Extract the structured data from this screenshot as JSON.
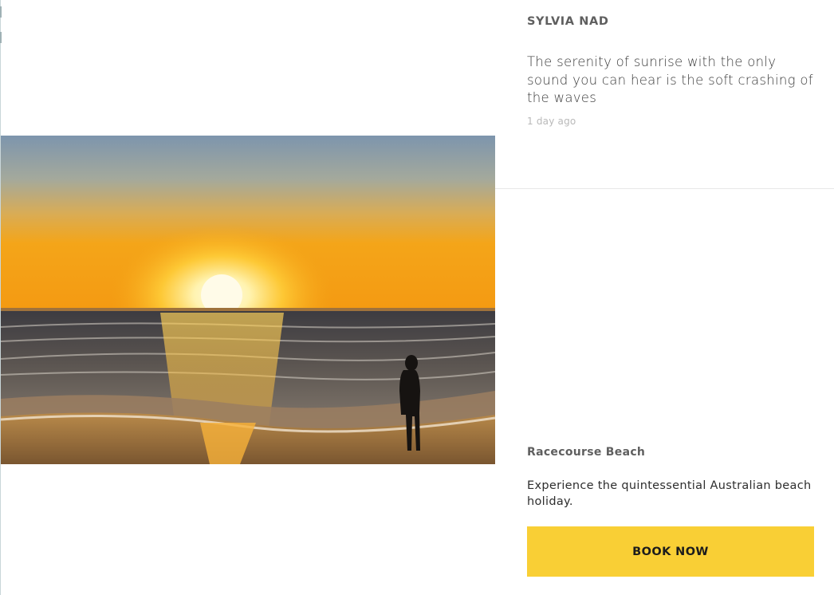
{
  "post": {
    "author": "SYLVIA NAD",
    "text": "The serenity of sunrise with the only sound you can hear is the soft crashing of the waves",
    "time": "1 day ago"
  },
  "listing": {
    "name": "Racecourse Beach",
    "description": "Experience the quintessential Australian beach holiday.",
    "cta_label": "BOOK NOW"
  },
  "colors": {
    "cta_background": "#f9cf35",
    "heading": "#5f5f5f",
    "muted": "#b9b9b9"
  }
}
